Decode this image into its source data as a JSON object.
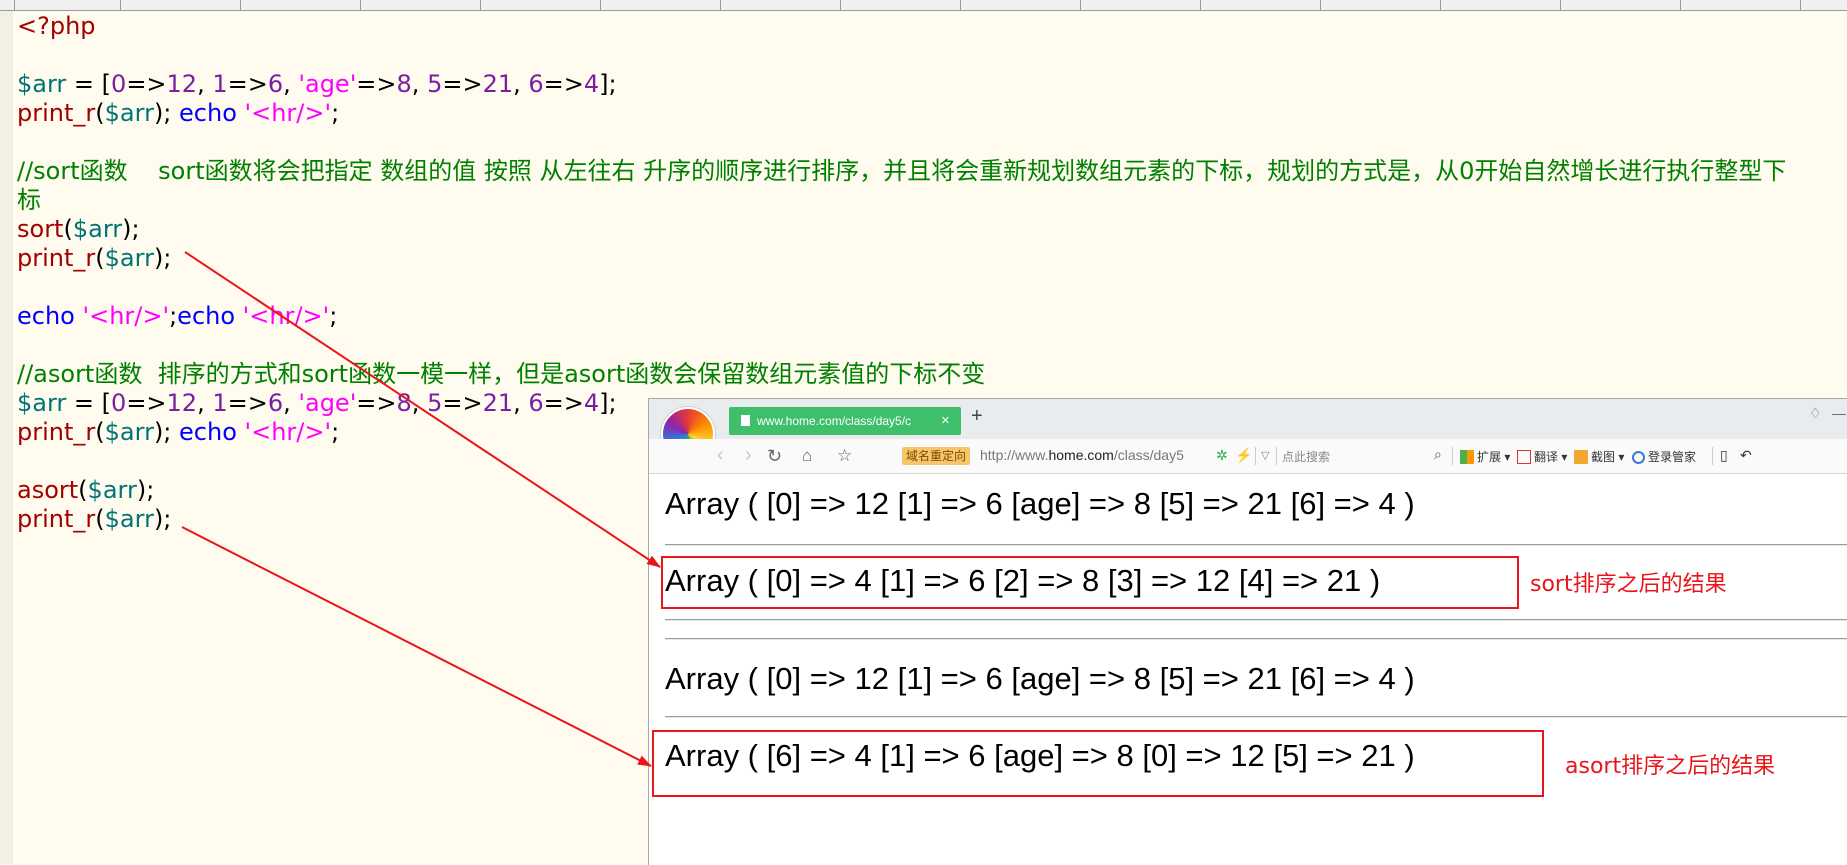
{
  "code_lines": [
    [
      {
        "t": "<?php",
        "c": "kw"
      }
    ],
    [],
    [
      {
        "t": "$arr",
        "c": "var"
      },
      {
        "t": " = [",
        "c": "plain"
      },
      {
        "t": "0",
        "c": "num"
      },
      {
        "t": "=>",
        "c": "plain"
      },
      {
        "t": "12",
        "c": "num"
      },
      {
        "t": ", ",
        "c": "plain"
      },
      {
        "t": "1",
        "c": "num"
      },
      {
        "t": "=>",
        "c": "plain"
      },
      {
        "t": "6",
        "c": "num"
      },
      {
        "t": ", ",
        "c": "plain"
      },
      {
        "t": "'age'",
        "c": "str"
      },
      {
        "t": "=>",
        "c": "plain"
      },
      {
        "t": "8",
        "c": "num"
      },
      {
        "t": ", ",
        "c": "plain"
      },
      {
        "t": "5",
        "c": "num"
      },
      {
        "t": "=>",
        "c": "plain"
      },
      {
        "t": "21",
        "c": "num"
      },
      {
        "t": ", ",
        "c": "plain"
      },
      {
        "t": "6",
        "c": "num"
      },
      {
        "t": "=>",
        "c": "plain"
      },
      {
        "t": "4",
        "c": "num"
      },
      {
        "t": "];",
        "c": "plain"
      }
    ],
    [
      {
        "t": "print_r",
        "c": "kw"
      },
      {
        "t": "(",
        "c": "plain"
      },
      {
        "t": "$arr",
        "c": "var"
      },
      {
        "t": "); ",
        "c": "plain"
      },
      {
        "t": "echo",
        "c": "fn"
      },
      {
        "t": " ",
        "c": "plain"
      },
      {
        "t": "'<hr/>'",
        "c": "str"
      },
      {
        "t": ";",
        "c": "plain"
      }
    ],
    [],
    [
      {
        "t": "//sort函数    sort函数将会把指定 数组的值 按照 从左往右 升序的顺序进行排序，并且将会重新规划数组元素的下标，规划的方式是，从0开始自然增长进行执行整型下",
        "c": "cm"
      }
    ],
    [
      {
        "t": "标",
        "c": "cm"
      }
    ],
    [
      {
        "t": "sort",
        "c": "kw"
      },
      {
        "t": "(",
        "c": "plain"
      },
      {
        "t": "$arr",
        "c": "var"
      },
      {
        "t": ");",
        "c": "plain"
      }
    ],
    [
      {
        "t": "print_r",
        "c": "kw"
      },
      {
        "t": "(",
        "c": "plain"
      },
      {
        "t": "$arr",
        "c": "var"
      },
      {
        "t": ");",
        "c": "plain"
      }
    ],
    [],
    [
      {
        "t": "echo",
        "c": "fn"
      },
      {
        "t": " ",
        "c": "plain"
      },
      {
        "t": "'<hr/>'",
        "c": "str"
      },
      {
        "t": ";",
        "c": "plain"
      },
      {
        "t": "echo",
        "c": "fn"
      },
      {
        "t": " ",
        "c": "plain"
      },
      {
        "t": "'<hr/>'",
        "c": "str"
      },
      {
        "t": ";",
        "c": "plain"
      }
    ],
    [],
    [
      {
        "t": "//asort函数  排序的方式和sort函数一模一样，但是asort函数会保留数组元素值的下标不变",
        "c": "cm"
      }
    ],
    [
      {
        "t": "$arr",
        "c": "var"
      },
      {
        "t": " = [",
        "c": "plain"
      },
      {
        "t": "0",
        "c": "num"
      },
      {
        "t": "=>",
        "c": "plain"
      },
      {
        "t": "12",
        "c": "num"
      },
      {
        "t": ", ",
        "c": "plain"
      },
      {
        "t": "1",
        "c": "num"
      },
      {
        "t": "=>",
        "c": "plain"
      },
      {
        "t": "6",
        "c": "num"
      },
      {
        "t": ", ",
        "c": "plain"
      },
      {
        "t": "'age'",
        "c": "str"
      },
      {
        "t": "=>",
        "c": "plain"
      },
      {
        "t": "8",
        "c": "num"
      },
      {
        "t": ", ",
        "c": "plain"
      },
      {
        "t": "5",
        "c": "num"
      },
      {
        "t": "=>",
        "c": "plain"
      },
      {
        "t": "21",
        "c": "num"
      },
      {
        "t": ", ",
        "c": "plain"
      },
      {
        "t": "6",
        "c": "num"
      },
      {
        "t": "=>",
        "c": "plain"
      },
      {
        "t": "4",
        "c": "num"
      },
      {
        "t": "];",
        "c": "plain"
      }
    ],
    [
      {
        "t": "print_r",
        "c": "kw"
      },
      {
        "t": "(",
        "c": "plain"
      },
      {
        "t": "$arr",
        "c": "var"
      },
      {
        "t": "); ",
        "c": "plain"
      },
      {
        "t": "echo",
        "c": "fn"
      },
      {
        "t": " ",
        "c": "plain"
      },
      {
        "t": "'<hr/>'",
        "c": "str"
      },
      {
        "t": ";",
        "c": "plain"
      }
    ],
    [],
    [
      {
        "t": "asort",
        "c": "kw"
      },
      {
        "t": "(",
        "c": "plain"
      },
      {
        "t": "$arr",
        "c": "var"
      },
      {
        "t": ");",
        "c": "plain"
      }
    ],
    [
      {
        "t": "print_r",
        "c": "kw"
      },
      {
        "t": "(",
        "c": "plain"
      },
      {
        "t": "$arr",
        "c": "var"
      },
      {
        "t": ");",
        "c": "plain"
      }
    ]
  ],
  "browser": {
    "tab_title": "www.home.com/class/day5/c",
    "tab_close": "×",
    "new_tab": "+",
    "redirect_badge": "域名重定向",
    "url_prefix": "http://www.",
    "url_host": "home.com",
    "url_path": "/class/day5",
    "search_placeholder": "点此搜索",
    "tools": {
      "extensions": "扩展",
      "translate": "翻译",
      "screenshot": "截图",
      "login_manager": "登录管家"
    }
  },
  "output": {
    "line1": "Array ( [0] => 12 [1] => 6 [age] => 8 [5] => 21 [6] => 4 )",
    "line2": "Array ( [0] => 4 [1] => 6 [2] => 8 [3] => 12 [4] => 21 )",
    "line3": "Array ( [0] => 12 [1] => 6 [age] => 8 [5] => 21 [6] => 4 )",
    "line4": "Array ( [6] => 4 [1] => 6 [age] => 8 [0] => 12 [5] => 21 )"
  },
  "annotations": {
    "sort_result": "sort排序之后的结果",
    "asort_result": "asort排序之后的结果"
  },
  "colors": {
    "annotation_red": "#e8161b",
    "tab_green": "#3fbf6a",
    "editor_bg": "#fffbef"
  }
}
